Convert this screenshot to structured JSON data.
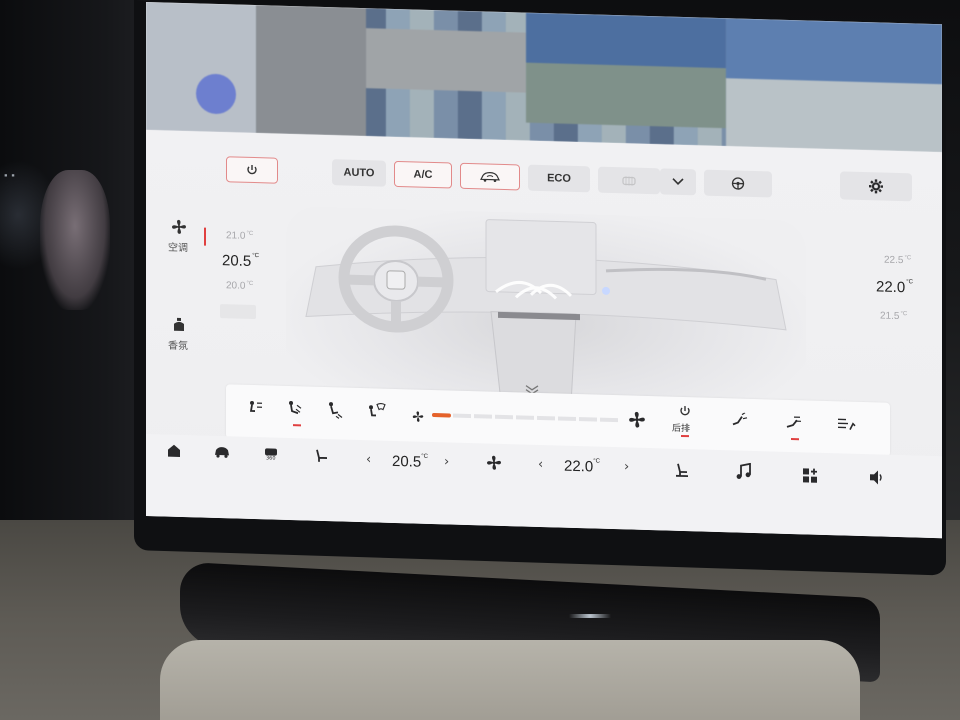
{
  "climate": {
    "top_controls": {
      "power_icon": "power-icon",
      "auto_label": "AUTO",
      "ac_label": "A/C",
      "recirc_icon": "car-recirculation-icon",
      "eco_label": "ECO",
      "defrost_icon": "rear-defrost-icon",
      "dropdown_icon": "chevron-down-icon",
      "steering_heat_icon": "steering-wheel-icon",
      "settings_icon": "gear-icon"
    },
    "left": {
      "ac_label": "空调",
      "fragrance_label": "香氛",
      "temp_above": "21.0",
      "temp_current": "20.5",
      "temp_below": "20.0",
      "unit": "°C"
    },
    "right": {
      "temp_above": "22.5",
      "temp_current": "22.0",
      "temp_below": "21.5",
      "unit": "°C"
    },
    "fan_row": {
      "fan_level": 0.1,
      "rear_label": "后排"
    },
    "accent_color": "#e04040"
  },
  "dock": {
    "driver_temp": "20.5",
    "passenger_temp": "22.0",
    "unit": "°C",
    "left_chevron": "‹",
    "right_chevron": "›"
  }
}
